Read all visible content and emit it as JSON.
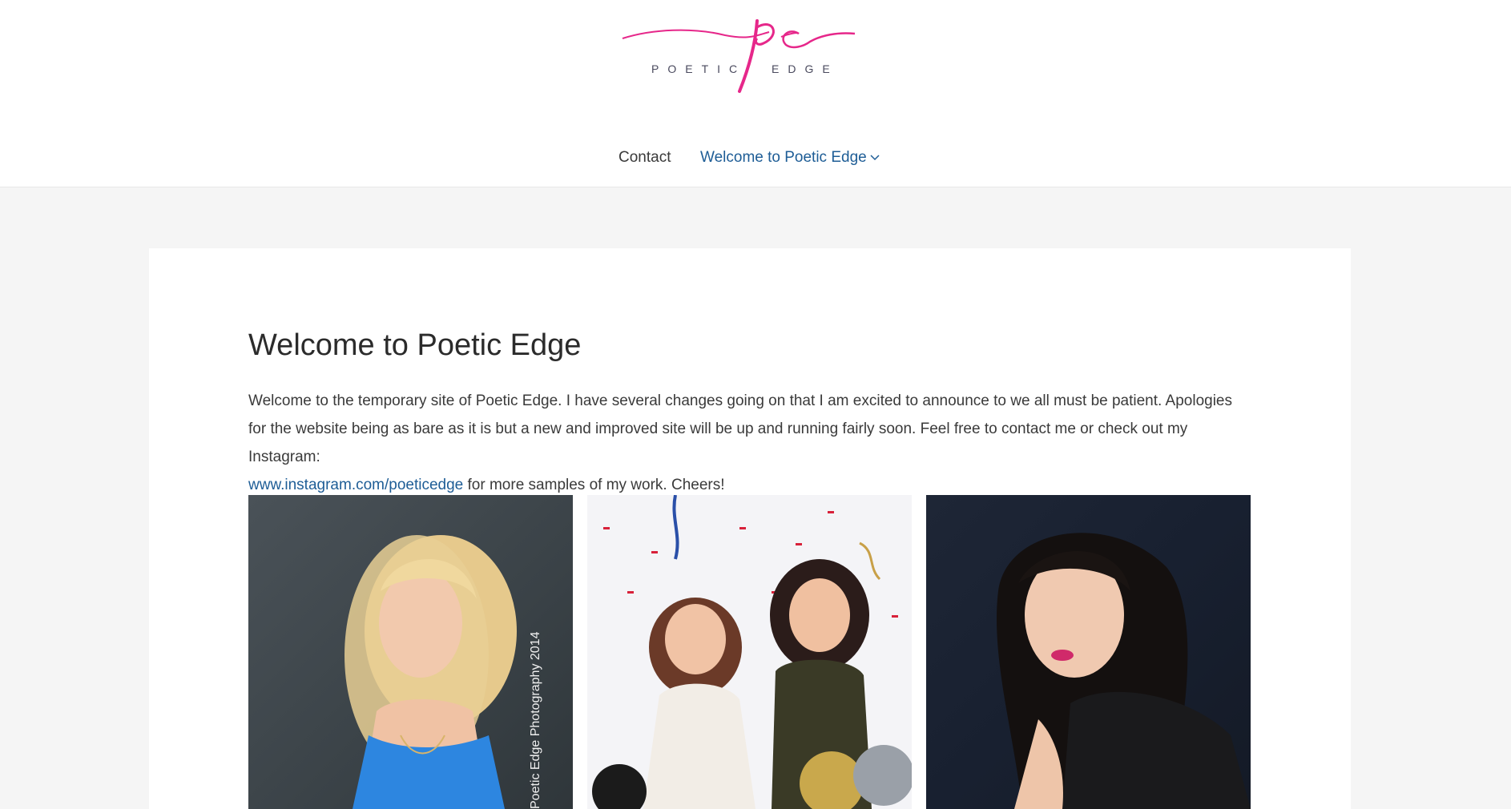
{
  "header": {
    "logo": {
      "monogram": "pe",
      "wordmark_left": "POETIC",
      "wordmark_right": "EDGE",
      "brand_color": "#e6278a"
    },
    "nav": {
      "contact_label": "Contact",
      "welcome_label": "Welcome to Poetic Edge",
      "active_color": "#1e5d96"
    }
  },
  "main": {
    "title": "Welcome to Poetic Edge",
    "intro": "Welcome to the temporary site of Poetic Edge. I have several changes going on that I am excited to announce to we all must be patient. Apologies for the website being as bare as it is but a new and improved site will be up and running fairly soon. Feel free to contact me or check out my Instagram:",
    "instagram_link": "www.instagram.com/poeticedge",
    "outro": " for more samples of my work. Cheers!",
    "photos": [
      {
        "watermark": "Poetic Edge Photography 2014"
      },
      {},
      {}
    ]
  }
}
